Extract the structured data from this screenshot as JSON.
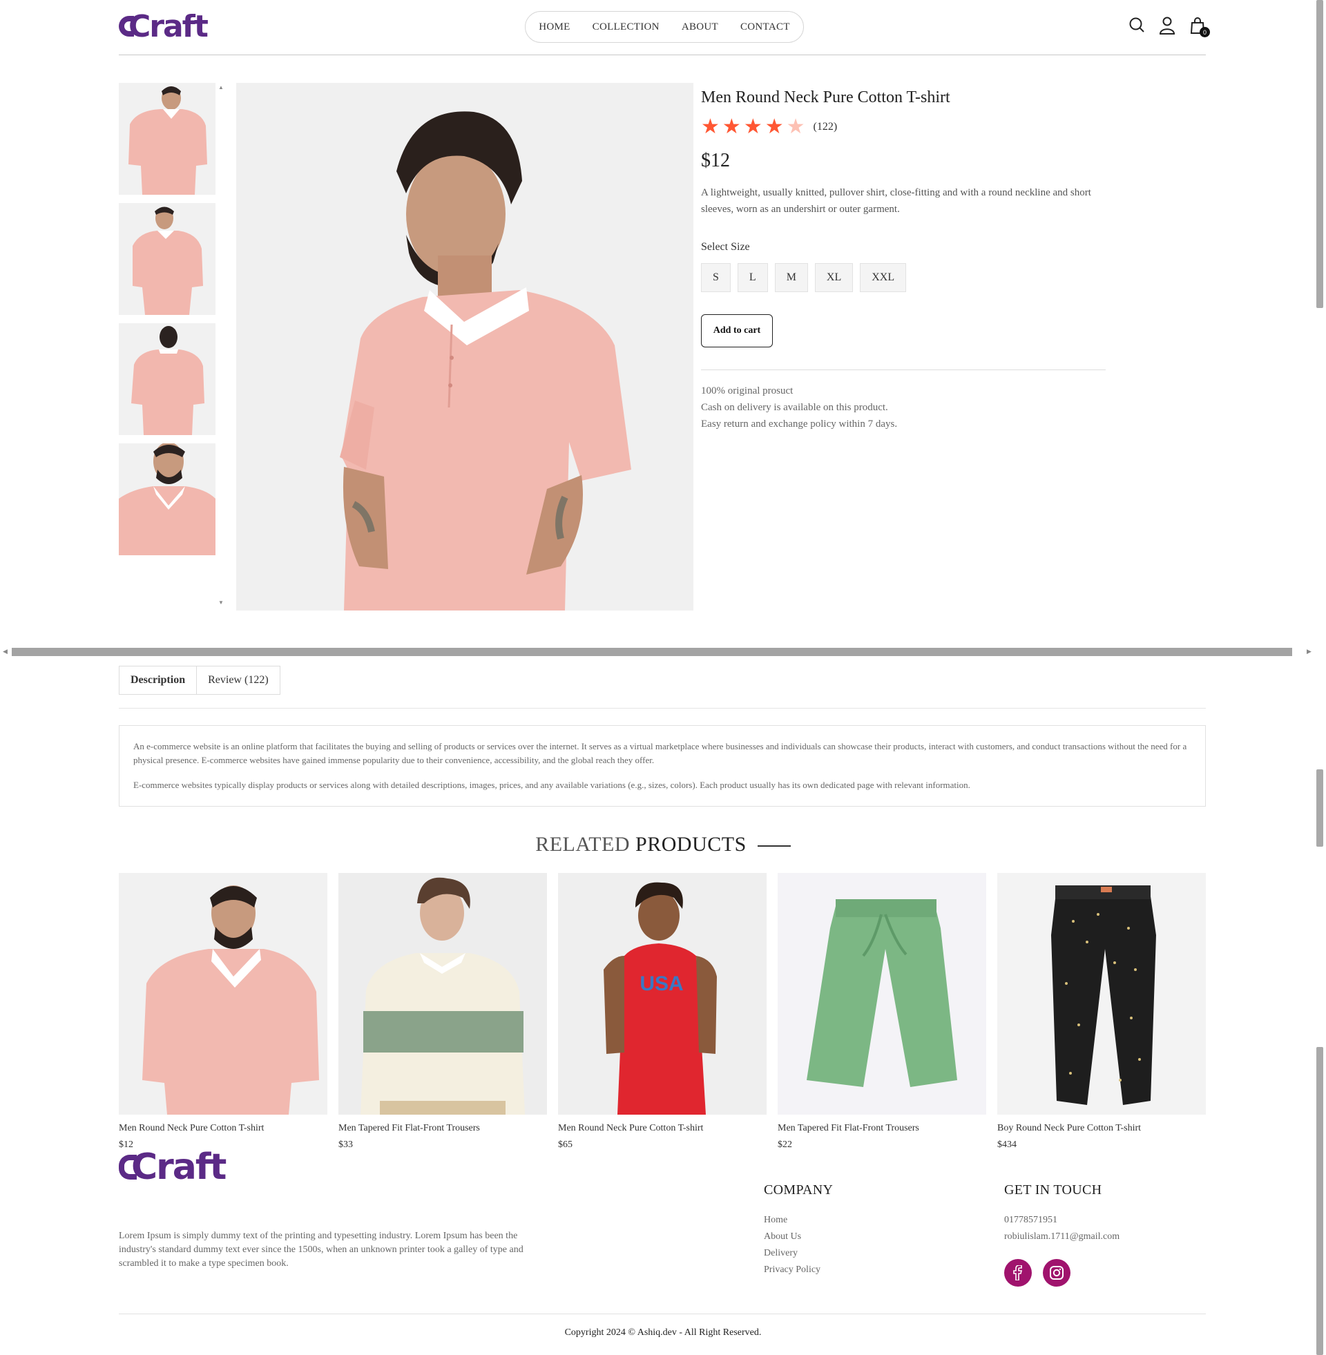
{
  "brand": {
    "logo_text": "Craft"
  },
  "nav": {
    "items": [
      "HOME",
      "COLLECTION",
      "ABOUT",
      "CONTACT"
    ]
  },
  "header": {
    "cart_count": "0",
    "icons": [
      "search-icon",
      "user-icon",
      "cart-icon"
    ]
  },
  "product": {
    "title": "Men Round Neck Pure Cotton T-shirt",
    "rating": 4,
    "rating_max": 5,
    "rating_count": "(122)",
    "price": "$12",
    "description": "A lightweight, usually knitted, pullover shirt, close-fitting and with a round neckline and short sleeves, worn as an undershirt or outer garment.",
    "size_label": "Select Size",
    "sizes": [
      "S",
      "L",
      "M",
      "XL",
      "XXL"
    ],
    "add_to_cart": "Add to cart",
    "policies": [
      "100% original prosuct",
      "Cash on delivery is available on this product.",
      "Easy return and exchange policy within 7 days."
    ],
    "thumbnails": 4
  },
  "tabs": {
    "description": "Description",
    "review": "Review (122)"
  },
  "description_box": {
    "p1": "An e-commerce website is an online platform that facilitates the buying and selling of products or services over the internet. It serves as a virtual marketplace where businesses and individuals can showcase their products, interact with customers, and conduct transactions without the need for a physical presence. E-commerce websites have gained immense popularity due to their convenience, accessibility, and the global reach they offer.",
    "p2": "E-commerce websites typically display products or services along with detailed descriptions, images, prices, and any available variations (e.g., sizes, colors). Each product usually has its own dedicated page with relevant information."
  },
  "related": {
    "title_light": "RELATED",
    "title_bold": "PRODUCTS",
    "items": [
      {
        "name": "Men Round Neck Pure Cotton T-shirt",
        "price": "$12"
      },
      {
        "name": "Men Tapered Fit Flat-Front Trousers",
        "price": "$33"
      },
      {
        "name": "Men Round Neck Pure Cotton T-shirt",
        "price": "$65"
      },
      {
        "name": "Men Tapered Fit Flat-Front Trousers",
        "price": "$22"
      },
      {
        "name": "Boy Round Neck Pure Cotton T-shirt",
        "price": "$434"
      }
    ]
  },
  "footer": {
    "about": "Lorem Ipsum is simply dummy text of the printing and typesetting industry. Lorem Ipsum has been the industry's standard dummy text ever since the 1500s, when an unknown printer took a galley of type and scrambled it to make a type specimen book.",
    "company_title": "COMPANY",
    "company_links": [
      "Home",
      "About Us",
      "Delivery",
      "Privacy Policy"
    ],
    "contact_title": "GET IN TOUCH",
    "phone": "01778571951",
    "email": "robiulislam.1711@gmail.com",
    "socials": [
      "facebook-icon",
      "instagram-icon"
    ],
    "copyright": "Copyright 2024 © Ashiq.dev - All Right Reserved."
  },
  "colors": {
    "brand": "#5b2a86",
    "star": "#ff5733",
    "social": "#a0136d"
  }
}
